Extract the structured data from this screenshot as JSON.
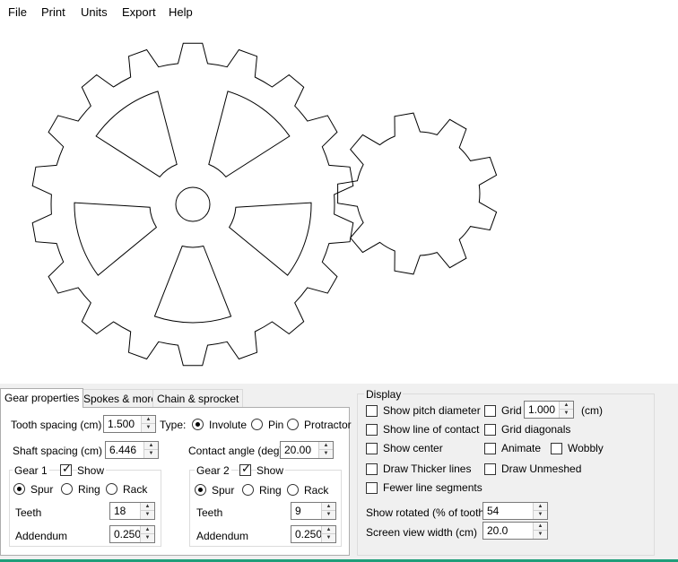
{
  "menu": [
    "File",
    "Print",
    "Units",
    "Export",
    "Help"
  ],
  "tabs": [
    {
      "label": "Gear properties",
      "active": true
    },
    {
      "label": "Spokes & more",
      "active": false
    },
    {
      "label": "Chain & sprocket",
      "active": false
    }
  ],
  "gear_props": {
    "tooth_spacing_label": "Tooth spacing (cm)",
    "tooth_spacing": "1.500",
    "type_label": "Type:",
    "types": [
      "Involute",
      "Pin",
      "Protractor"
    ],
    "type_selected": "Involute",
    "shaft_spacing_label": "Shaft spacing (cm)",
    "shaft_spacing": "6.446",
    "contact_angle_label": "Contact angle (deg)",
    "contact_angle": "20.00",
    "gear1": {
      "title": "Gear 1",
      "show_label": "Show",
      "show": true,
      "kinds": [
        "Spur",
        "Ring",
        "Rack"
      ],
      "kind_selected": "Spur",
      "teeth_label": "Teeth",
      "teeth": "18",
      "addendum_label": "Addendum",
      "addendum": "0.250"
    },
    "gear2": {
      "title": "Gear 2",
      "show_label": "Show",
      "show": true,
      "kinds": [
        "Spur",
        "Ring",
        "Rack"
      ],
      "kind_selected": "Spur",
      "teeth_label": "Teeth",
      "teeth": "9",
      "addendum_label": "Addendum",
      "addendum": "0.250"
    }
  },
  "display": {
    "title": "Display",
    "show_pitch_diameter": "Show pitch diameter",
    "grid": "Grid",
    "grid_value": "1.000",
    "grid_unit": "(cm)",
    "show_line_of_contact": "Show line of contact",
    "grid_diagonals": "Grid diagonals",
    "show_center": "Show center",
    "animate": "Animate",
    "wobbly": "Wobbly",
    "draw_thicker_lines": "Draw Thicker lines",
    "draw_unmeshed": "Draw Unmeshed",
    "fewer_line_segments": "Fewer line segments",
    "show_rotated_label": "Show rotated (% of tooth)",
    "show_rotated": "54",
    "screen_view_width_label": "Screen view width (cm)",
    "screen_view_width": "20.0"
  },
  "colors": {
    "gear_stroke": "#000000",
    "status_accent": "#1f9e7a"
  }
}
